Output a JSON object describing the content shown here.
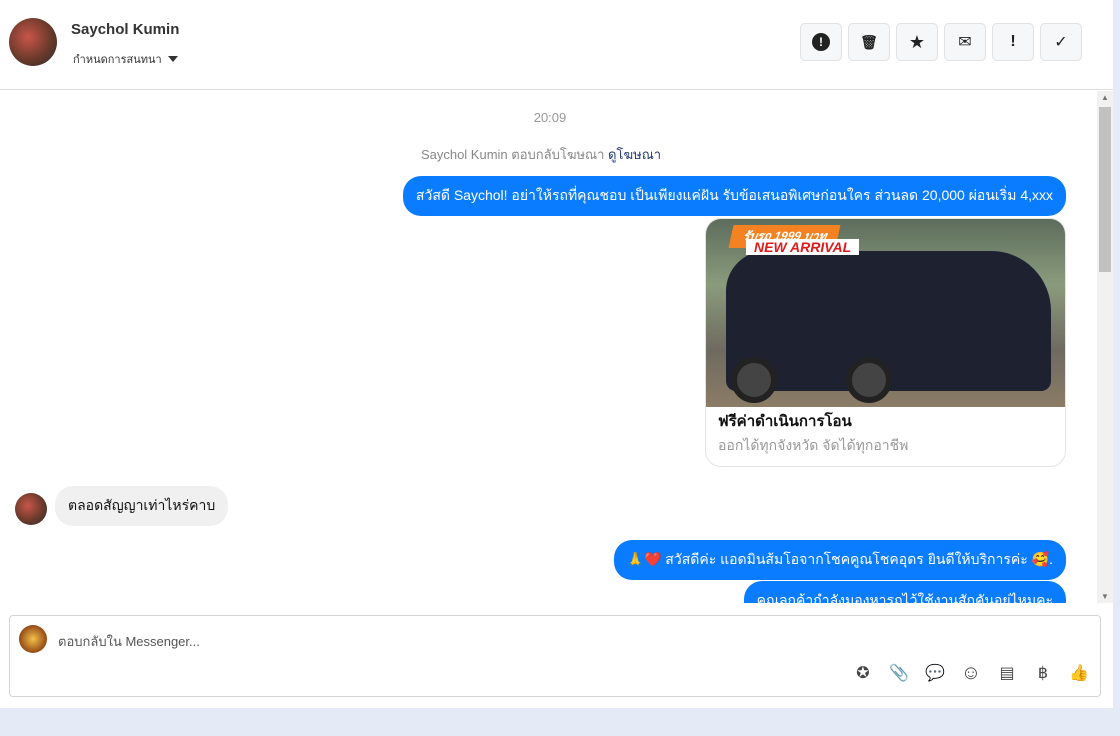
{
  "header": {
    "name": "Saychol Kumin",
    "assign_label": "กำหนดการสนทนา",
    "actions": [
      {
        "name": "report",
        "glyph": "!"
      },
      {
        "name": "delete",
        "glyph": "🗑"
      },
      {
        "name": "star",
        "glyph": "★"
      },
      {
        "name": "mark-unread",
        "glyph": "✉"
      },
      {
        "name": "important",
        "glyph": "!"
      },
      {
        "name": "done",
        "glyph": "✓"
      }
    ]
  },
  "chat": {
    "time": "20:09",
    "notice_text": "Saychol Kumin ตอบกลับโฆษณา",
    "notice_link": "ดูโฆษณา",
    "messages": [
      {
        "from": "page",
        "text": "สวัสดี Saychol! อย่าให้รถที่คุณชอบ เป็นเพียงแค่ฝัน รับข้อเสนอพิเศษก่อนใคร ส่วนลด 20,000 ผ่อนเริ่ม 4,xxx"
      },
      {
        "from": "customer",
        "text": "ตลอดสัญญาเท่าไหร่คาบ"
      },
      {
        "from": "page",
        "text": "🙏❤️ สวัสดีค่ะ แอดมินส้มโอจากโชคคูณโชคอุดร ยินดีให้บริการค่ะ 🥰."
      },
      {
        "from": "page",
        "text": "คุณลูกค้ากำลังมองหารถไว้ใช้งานสักคันอยู่ไหมคะ"
      }
    ],
    "card": {
      "banner_top": "รับรถ 1999 บาท",
      "banner_main": "NEW ARRIVAL",
      "title": "ฟรีค่าดำเนินการโอน",
      "subtitle": "ออกได้ทุกจังหวัด จัดได้ทุกอาชีพ"
    }
  },
  "composer": {
    "placeholder": "ตอบกลับใน Messenger...",
    "tools": [
      {
        "name": "saved-reply",
        "glyph": "✪"
      },
      {
        "name": "attach",
        "glyph": "📎"
      },
      {
        "name": "chat",
        "glyph": "💬"
      },
      {
        "name": "emoji",
        "glyph": "☺"
      },
      {
        "name": "catalog",
        "glyph": "▤"
      },
      {
        "name": "payment",
        "glyph": "฿"
      },
      {
        "name": "like",
        "glyph": "👍"
      }
    ]
  }
}
